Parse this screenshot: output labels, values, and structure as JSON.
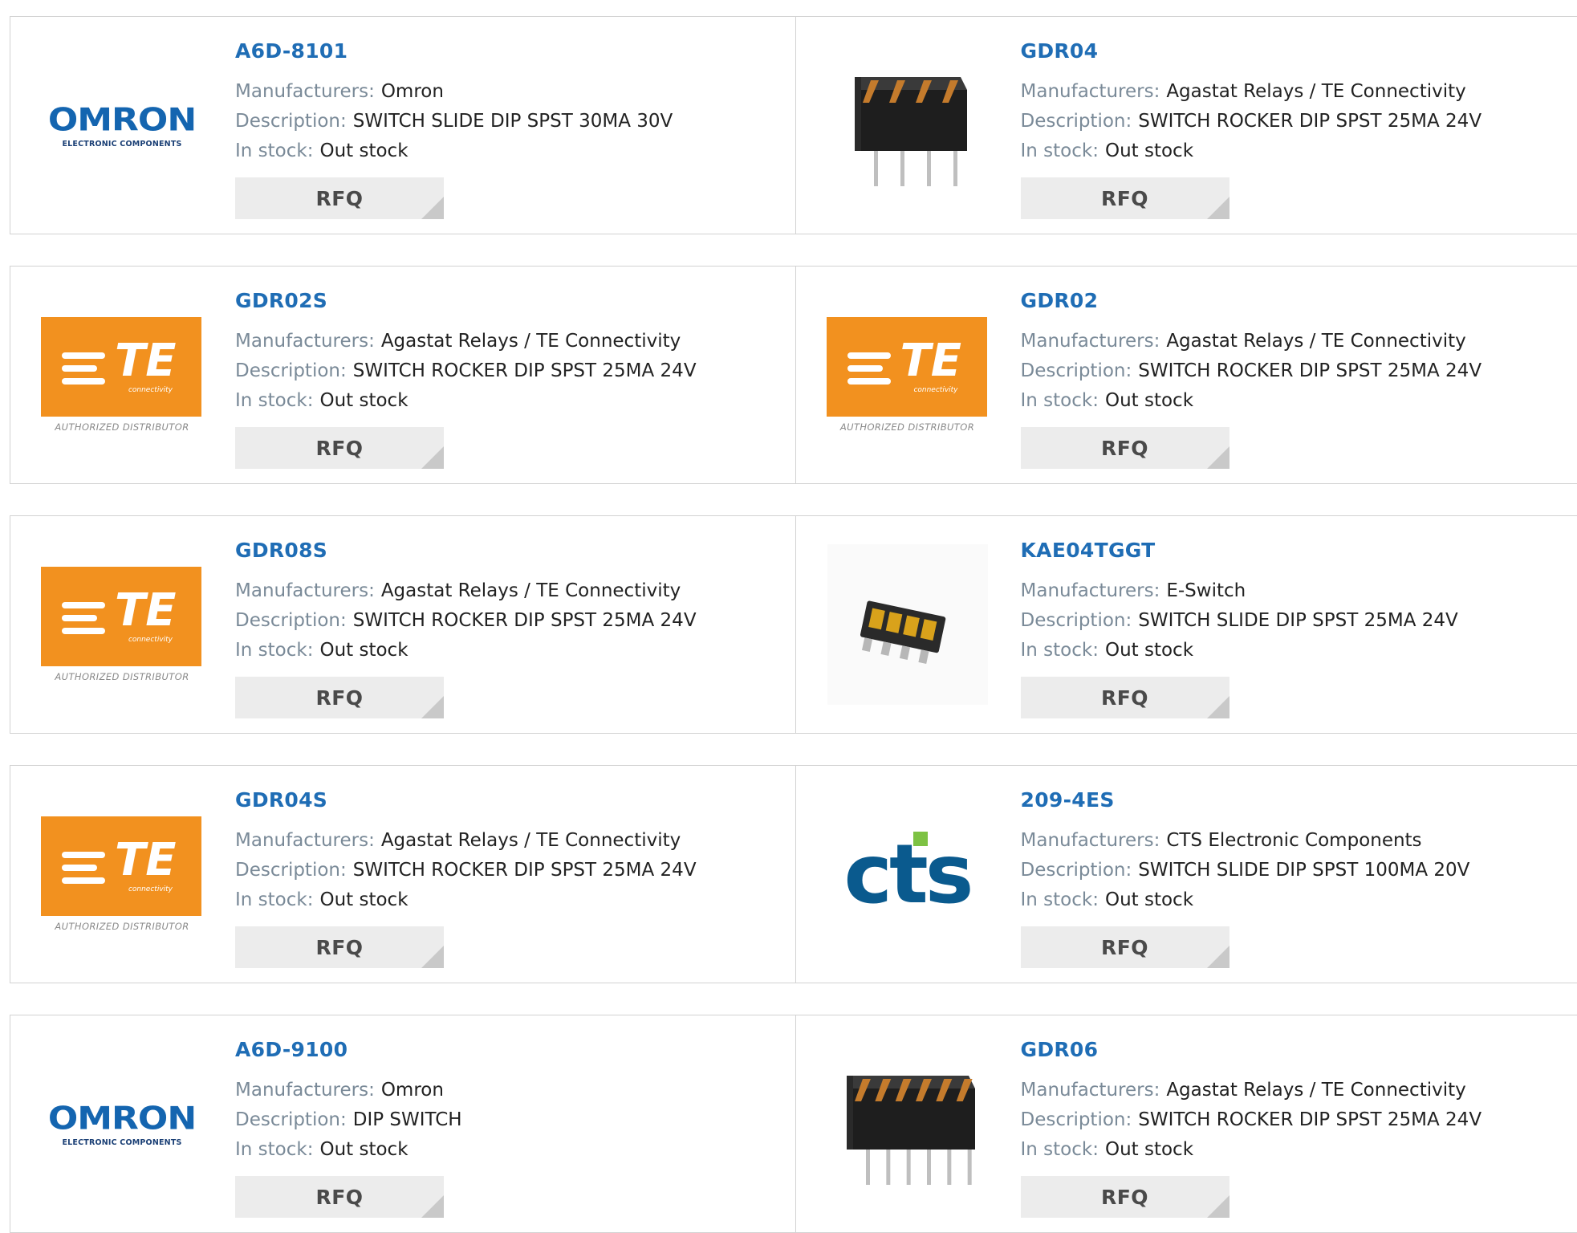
{
  "labels": {
    "manufacturers": "Manufacturers:",
    "description": "Description:",
    "stock": "In stock:",
    "rfq": "RFQ"
  },
  "logo_text": {
    "omron": "OMRON",
    "omron_sub": "ELECTRONIC COMPONENTS",
    "te": "TE",
    "te_conn": "connectivity",
    "te_auth": "AUTHORIZED DISTRIBUTOR",
    "cts": "cts"
  },
  "products": [
    {
      "part": "A6D-8101",
      "manufacturer": "Omron",
      "description": "SWITCH SLIDE DIP SPST 30MA 30V",
      "stock": "Out stock",
      "image": "omron-logo"
    },
    {
      "part": "GDR04",
      "manufacturer": "Agastat Relays / TE Connectivity",
      "description": "SWITCH ROCKER DIP SPST 25MA 24V",
      "stock": "Out stock",
      "image": "dip-switch-4-photo"
    },
    {
      "part": "GDR02S",
      "manufacturer": "Agastat Relays / TE Connectivity",
      "description": "SWITCH ROCKER DIP SPST 25MA 24V",
      "stock": "Out stock",
      "image": "te-logo"
    },
    {
      "part": "GDR02",
      "manufacturer": "Agastat Relays / TE Connectivity",
      "description": "SWITCH ROCKER DIP SPST 25MA 24V",
      "stock": "Out stock",
      "image": "te-logo"
    },
    {
      "part": "GDR08S",
      "manufacturer": "Agastat Relays / TE Connectivity",
      "description": "SWITCH ROCKER DIP SPST 25MA 24V",
      "stock": "Out stock",
      "image": "te-logo"
    },
    {
      "part": "KAE04TGGT",
      "manufacturer": "E-Switch",
      "description": "SWITCH SLIDE DIP SPST 25MA 24V",
      "stock": "Out stock",
      "image": "smd-dip-switch-photo"
    },
    {
      "part": "GDR04S",
      "manufacturer": "Agastat Relays / TE Connectivity",
      "description": "SWITCH ROCKER DIP SPST 25MA 24V",
      "stock": "Out stock",
      "image": "te-logo"
    },
    {
      "part": "209-4ES",
      "manufacturer": "CTS Electronic Components",
      "description": "SWITCH SLIDE DIP SPST 100MA 20V",
      "stock": "Out stock",
      "image": "cts-logo"
    },
    {
      "part": "A6D-9100",
      "manufacturer": "Omron",
      "description": "DIP SWITCH",
      "stock": "Out stock",
      "image": "omron-logo"
    },
    {
      "part": "GDR06",
      "manufacturer": "Agastat Relays / TE Connectivity",
      "description": "SWITCH ROCKER DIP SPST 25MA 24V",
      "stock": "Out stock",
      "image": "dip-switch-6-photo"
    }
  ],
  "colors": {
    "link": "#1f6db5",
    "label": "#7a8a98",
    "te_orange": "#f2911f",
    "omron_blue": "#1465b0",
    "cts_blue": "#0a5a8e",
    "cts_green": "#7dc243"
  }
}
